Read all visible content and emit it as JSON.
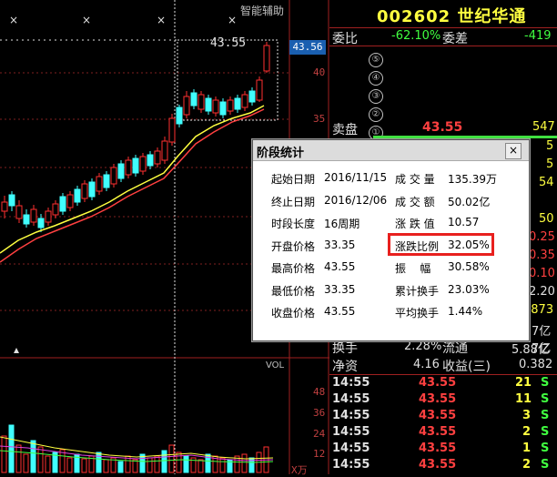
{
  "chart": {
    "top_right_label": "智能辅助",
    "current_price_tag": "43.56",
    "peak_label": "43.55",
    "y_ticks": [
      "40",
      "35"
    ],
    "volume_title": "VOL",
    "volume_ticks": [
      "48",
      "36",
      "24",
      "12"
    ],
    "volume_unit": "X万"
  },
  "stock": {
    "code": "002602",
    "name": "世纪华通",
    "webi_label": "委比",
    "webi_value": "-62.10%",
    "weicha_label": "委差",
    "weicha_value": "-419",
    "sell_levels": [
      "⑤",
      "④",
      "③",
      "②"
    ],
    "sell_label": "卖盘",
    "sell_level1": "①",
    "sell_price": "43.55",
    "sell_volume": "547"
  },
  "right_partial": [
    "5",
    "5",
    "54",
    "50",
    "0.25",
    "0.35",
    "0.10",
    "2.20",
    "0873",
    "7亿",
    "7亿"
  ],
  "stats": {
    "turnover_label": "换手",
    "turnover_value": "2.28%",
    "float_label": "流通",
    "float_value": "5.88亿",
    "netasset_label": "净资",
    "netasset_value": "4.16",
    "eps_label": "收益(三)",
    "eps_value": "0.382"
  },
  "ticks": [
    {
      "time": "14:55",
      "price": "43.55",
      "vol": "21",
      "side": "S"
    },
    {
      "time": "14:55",
      "price": "43.55",
      "vol": "11",
      "side": "S"
    },
    {
      "time": "14:55",
      "price": "43.55",
      "vol": "3",
      "side": "S"
    },
    {
      "time": "14:55",
      "price": "43.55",
      "vol": "2",
      "side": "S"
    },
    {
      "time": "14:55",
      "price": "43.55",
      "vol": "1",
      "side": "S"
    },
    {
      "time": "14:55",
      "price": "43.55",
      "vol": "2",
      "side": "S"
    }
  ],
  "dialog": {
    "title": "阶段统计",
    "close": "×",
    "left_rows": [
      {
        "label": "起始日期",
        "value": "2016/11/15"
      },
      {
        "label": "终止日期",
        "value": "2016/12/06"
      },
      {
        "label": "时段长度",
        "value": "16周期"
      },
      {
        "label": "开盘价格",
        "value": "33.35"
      },
      {
        "label": "最高价格",
        "value": "43.55"
      },
      {
        "label": "最低价格",
        "value": "33.35"
      },
      {
        "label": "收盘价格",
        "value": "43.55"
      }
    ],
    "right_rows": [
      {
        "label": "成 交 量",
        "value": "135.39万"
      },
      {
        "label": "成 交 额",
        "value": "50.02亿"
      },
      {
        "label": "涨 跌 值",
        "value": "10.57"
      },
      {
        "label": "涨跌比例",
        "value": "32.05%"
      },
      {
        "label": "振    幅",
        "value": "30.58%"
      },
      {
        "label": "累计换手",
        "value": "23.03%"
      },
      {
        "label": "平均换手",
        "value": "1.44%"
      }
    ]
  },
  "colors": {
    "up": "#ff3030",
    "down": "#40ffff",
    "ma_yellow": "#ffff40",
    "ma_red": "#ff4040",
    "highlight": "#e8201e"
  }
}
